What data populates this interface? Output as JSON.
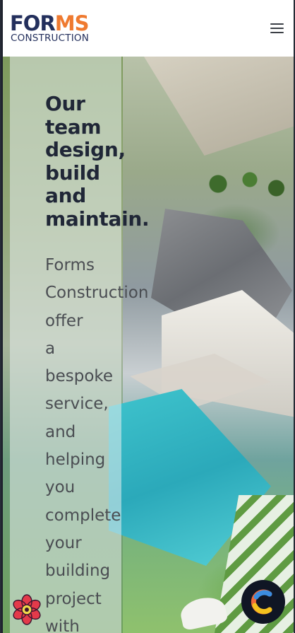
{
  "header": {
    "logo": {
      "part1": "FOR",
      "part2": "MS",
      "tagline": "CONSTRUCTION"
    },
    "menu_icon": "hamburger-menu-icon"
  },
  "hero": {
    "headline_lines": [
      "Our",
      "team",
      "design,",
      "build",
      "and",
      "maintain."
    ],
    "body_lines": [
      "Forms",
      "Construction",
      "offer",
      "a",
      "bespoke",
      "service,",
      "and",
      "helping",
      "you",
      "complete",
      "your",
      "building",
      "project",
      "with"
    ]
  },
  "floating": {
    "left_badge_icon": "flower-badge-icon",
    "right_badge_icon": "chat-c-logo-icon"
  },
  "colors": {
    "brand_navy": "#232f5c",
    "brand_orange": "#ef7a30",
    "headline": "#202737",
    "body": "#4a4d52"
  }
}
